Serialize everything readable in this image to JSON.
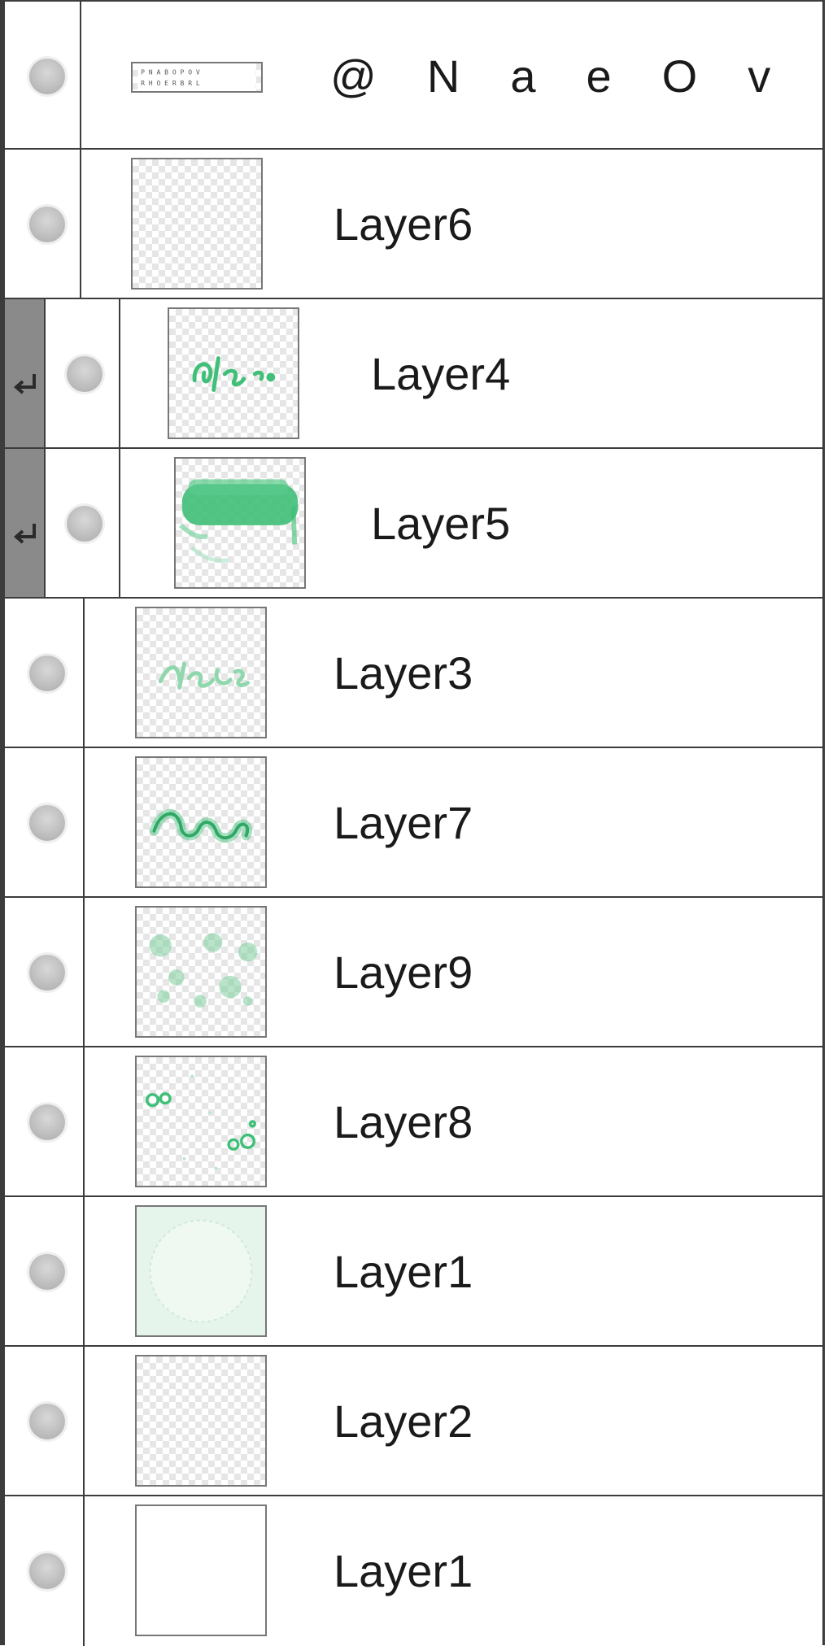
{
  "layers_panel": {
    "layers": [
      {
        "name": "@ N a e O v",
        "chars": [
          "@",
          "N",
          "a",
          "e",
          "O",
          "v"
        ],
        "kind": "text",
        "clipped": false,
        "thumbnail": "text-strip-icon"
      },
      {
        "name": "Layer6",
        "kind": "raster",
        "clipped": false,
        "thumbnail": "empty-transparent"
      },
      {
        "name": "Layer4",
        "kind": "raster",
        "clipped": true,
        "thumbnail": "green-script-small"
      },
      {
        "name": "Layer5",
        "kind": "raster",
        "clipped": true,
        "thumbnail": "green-brush-stroke"
      },
      {
        "name": "Layer3",
        "kind": "raster",
        "clipped": false,
        "thumbnail": "light-green-script"
      },
      {
        "name": "Layer7",
        "kind": "raster",
        "clipped": false,
        "thumbnail": "green-outlined-script"
      },
      {
        "name": "Layer9",
        "kind": "raster",
        "clipped": false,
        "thumbnail": "green-bokeh-dots"
      },
      {
        "name": "Layer8",
        "kind": "raster",
        "clipped": false,
        "thumbnail": "green-circles"
      },
      {
        "name": "Layer1",
        "kind": "raster",
        "clipped": false,
        "thumbnail": "pale-green-circle-fill"
      },
      {
        "name": "Layer2",
        "kind": "raster",
        "clipped": false,
        "thumbnail": "empty-transparent"
      },
      {
        "name": "Layer1",
        "kind": "raster",
        "clipped": false,
        "thumbnail": "white-fill"
      }
    ]
  },
  "colors": {
    "border": "#3c3c3c",
    "clip_strip": "#8a8a8a",
    "accent_green": "#3fbf78",
    "light_green": "#9ad9b5",
    "pale_green": "#e8f6ec"
  },
  "icons": {
    "visibility": "eye-dot-icon",
    "clipping": "clip-arrow-icon"
  }
}
